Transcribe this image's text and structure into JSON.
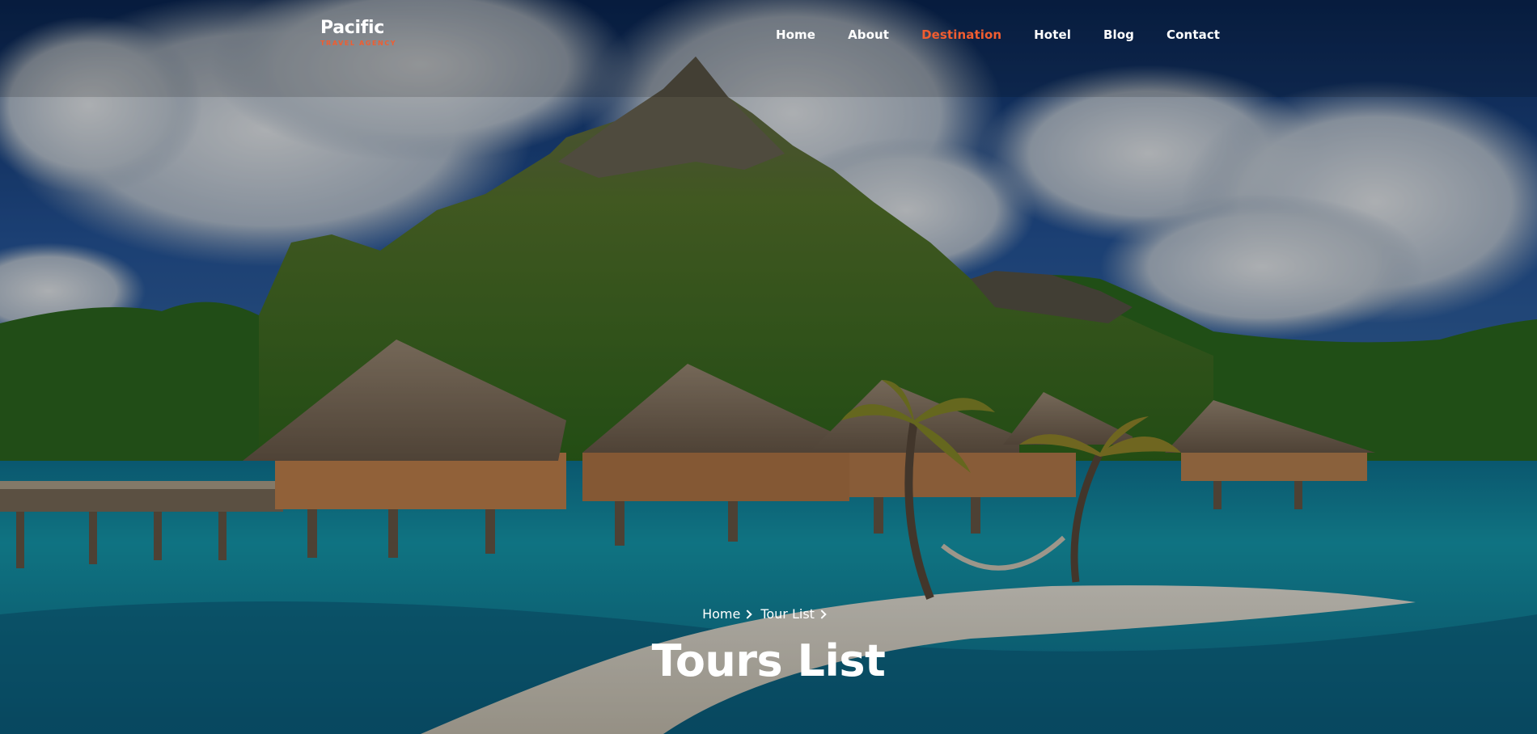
{
  "brand": {
    "name": "Pacific",
    "tagline": "TRAVEL AGENCY",
    "accent_color": "#f15d30"
  },
  "nav": {
    "items": [
      {
        "label": "Home"
      },
      {
        "label": "About"
      },
      {
        "label": "Destination",
        "active": true
      },
      {
        "label": "Hotel"
      },
      {
        "label": "Blog"
      },
      {
        "label": "Contact"
      }
    ]
  },
  "breadcrumb": {
    "home": "Home",
    "current": "Tour List",
    "separator_icon": "chevron-right-icon"
  },
  "page": {
    "title": "Tours List"
  }
}
